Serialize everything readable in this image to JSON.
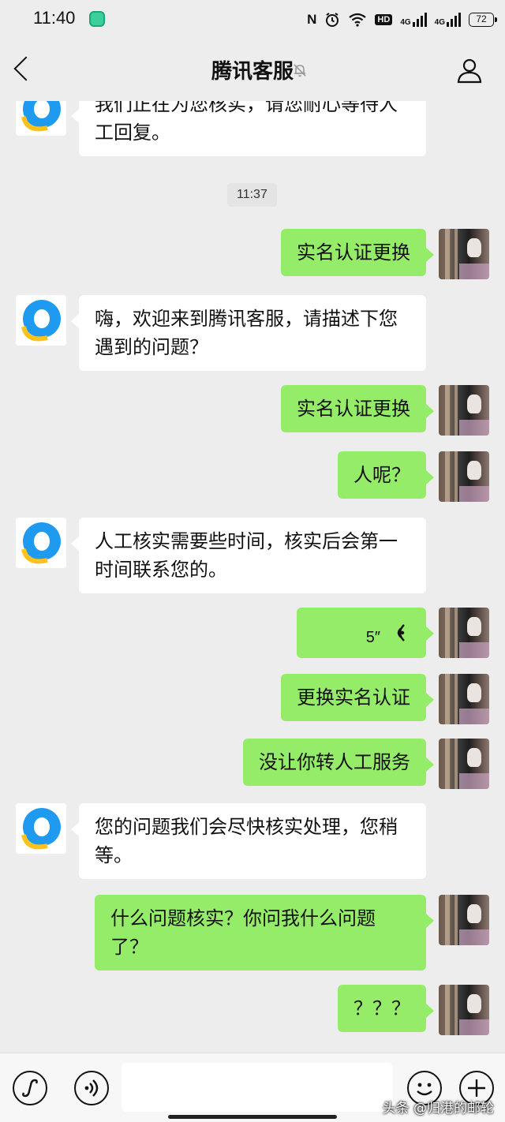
{
  "status_bar": {
    "time": "11:40",
    "nfc": "N",
    "hd": "HD",
    "network1": "4G",
    "network2": "4G",
    "battery": "72"
  },
  "nav": {
    "title": "腾讯客服"
  },
  "timestamp": "11:37",
  "messages": [
    {
      "side": "left",
      "text": "我们正在为您核实，请您耐心等待人工回复。"
    },
    {
      "side": "right",
      "text": "实名认证更换"
    },
    {
      "side": "left",
      "text": "嗨，欢迎来到腾讯客服，请描述下您遇到的问题？"
    },
    {
      "side": "right",
      "text": "实名认证更换"
    },
    {
      "side": "right",
      "text": "人呢？"
    },
    {
      "side": "left",
      "text": "人工核实需要些时间，核实后会第一时间联系您的。"
    },
    {
      "side": "right",
      "type": "voice",
      "text": "5″"
    },
    {
      "side": "right",
      "text": "更换实名认证"
    },
    {
      "side": "right",
      "text": "没让你转人工服务"
    },
    {
      "side": "left",
      "text": "您的问题我们会尽快核实处理，您稍等。"
    },
    {
      "side": "right",
      "text": "什么问题核实？你问我什么问题了？"
    },
    {
      "side": "right",
      "text": "？？？"
    }
  ],
  "input": {
    "value": ""
  },
  "watermark": "头条 @归港的邮轮",
  "colors": {
    "background": "#ededed",
    "bubble_right": "#95ec69",
    "bubble_left": "#ffffff",
    "qq_blue": "#1e9bf0",
    "qq_yellow": "#ffc21a"
  },
  "icons": {
    "back": "chevron-left-icon",
    "mute": "bell-muted-icon",
    "profile": "person-icon",
    "mini_program": "link-icon",
    "voice_mode": "voice-icon",
    "emoji": "emoji-icon",
    "more": "plus-icon"
  }
}
